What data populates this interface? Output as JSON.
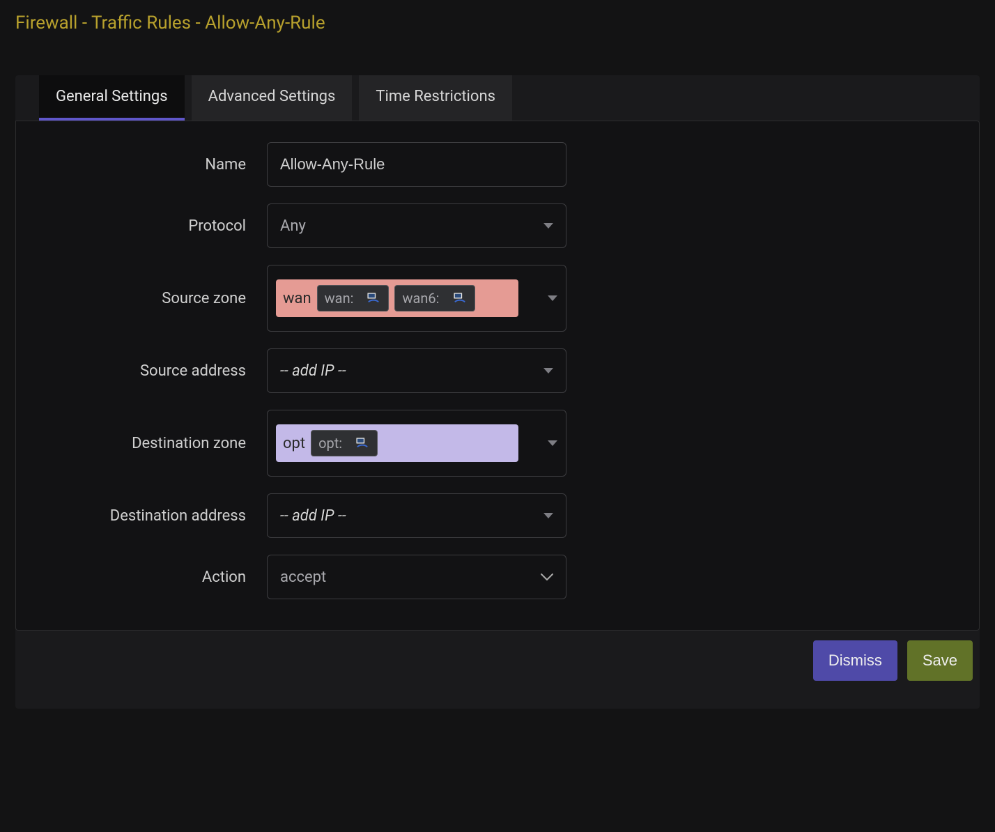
{
  "title": "Firewall - Traffic Rules - Allow-Any-Rule",
  "tabs": [
    {
      "label": "General Settings",
      "active": true
    },
    {
      "label": "Advanced Settings",
      "active": false
    },
    {
      "label": "Time Restrictions",
      "active": false
    }
  ],
  "fields": {
    "name": {
      "label": "Name",
      "value": "Allow-Any-Rule"
    },
    "protocol": {
      "label": "Protocol",
      "value": "Any"
    },
    "source_zone": {
      "label": "Source zone",
      "zone_name": "wan",
      "zone_color": "#e59b94",
      "interfaces": [
        {
          "label": "wan:"
        },
        {
          "label": "wan6:"
        }
      ]
    },
    "source_address": {
      "label": "Source address",
      "placeholder": "-- add IP --"
    },
    "destination_zone": {
      "label": "Destination zone",
      "zone_name": "opt",
      "zone_color": "#c3b9e8",
      "interfaces": [
        {
          "label": "opt:"
        }
      ]
    },
    "destination_address": {
      "label": "Destination address",
      "placeholder": "-- add IP --"
    },
    "action": {
      "label": "Action",
      "value": "accept"
    }
  },
  "buttons": {
    "dismiss": "Dismiss",
    "save": "Save"
  }
}
